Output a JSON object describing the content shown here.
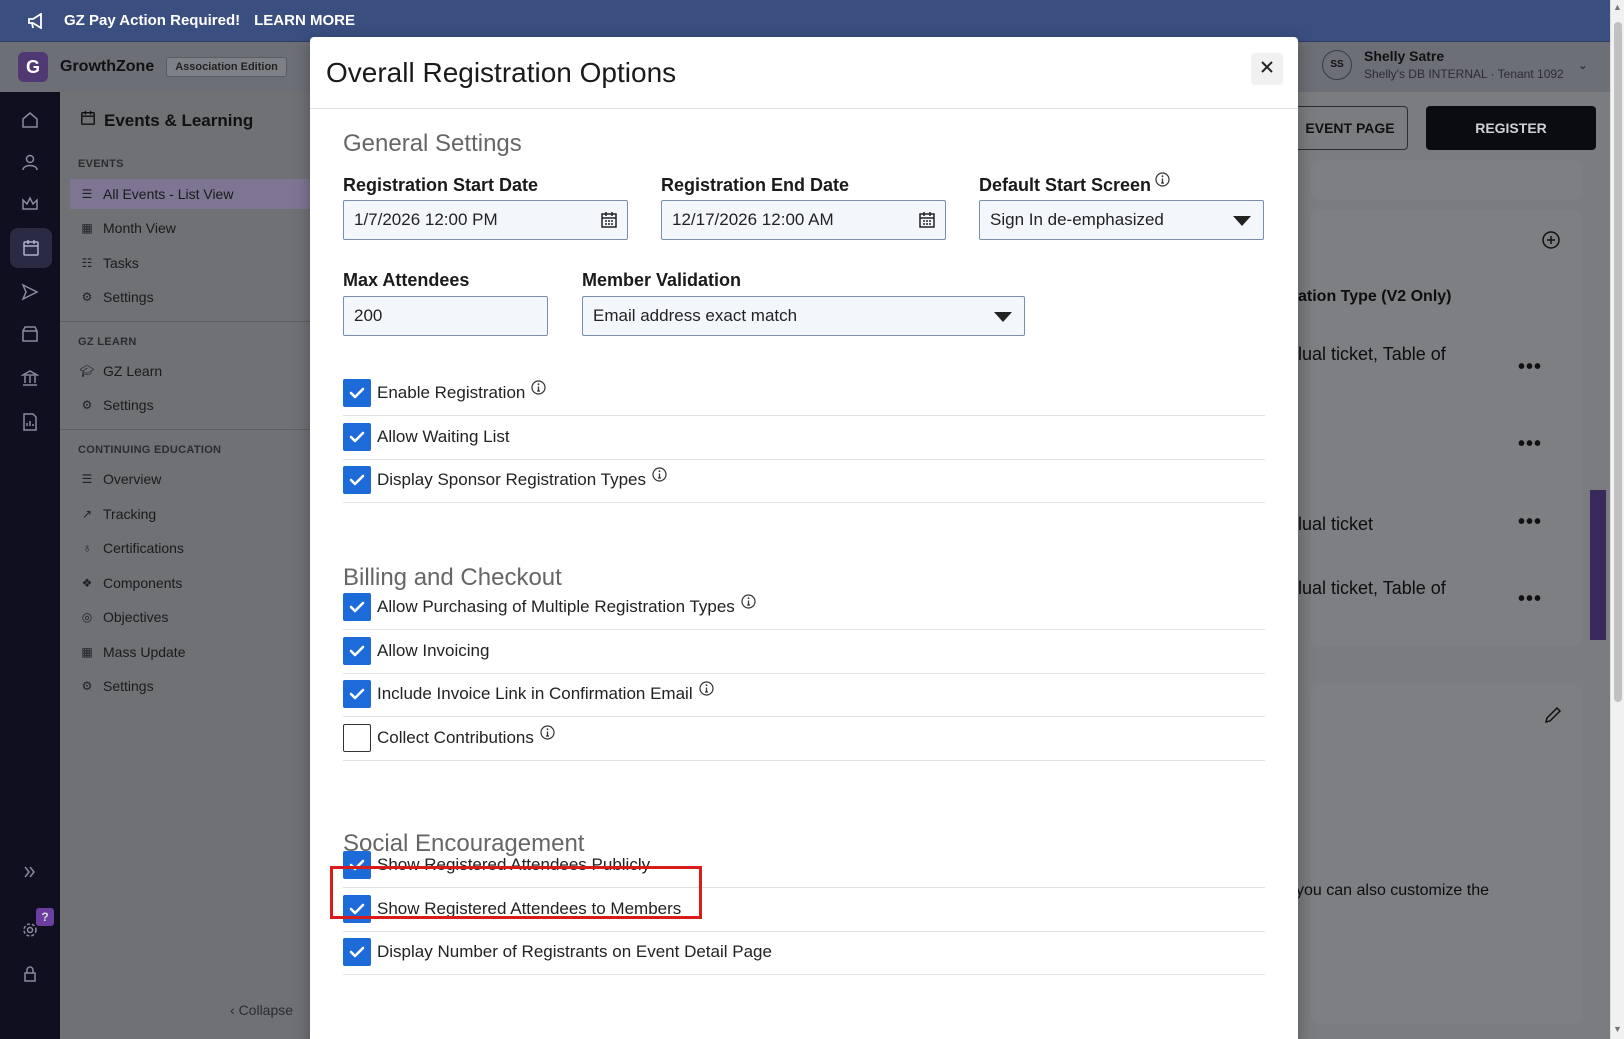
{
  "banner": {
    "text": "GZ Pay Action Required!",
    "link": "LEARN MORE"
  },
  "topbar": {
    "logo_letter": "G",
    "brand": "GrowthZone",
    "edition": "Association Edition",
    "user_initials": "SS",
    "user_name": "Shelly Satre",
    "user_sub": "Shelly's DB INTERNAL · Tenant 1092"
  },
  "sidenav": {
    "title": "Events & Learning",
    "sections": {
      "events": "EVENTS",
      "gz_learn": "GZ LEARN",
      "ce": "CONTINUING EDUCATION"
    },
    "events_items": [
      "All Events - List View",
      "Month View",
      "Tasks",
      "Settings"
    ],
    "learn_items": [
      "GZ Learn",
      "Settings"
    ],
    "ce_items": [
      "Overview",
      "Tracking",
      "Certifications",
      "Components",
      "Objectives",
      "Mass Update",
      "Settings"
    ],
    "collapse": "Collapse"
  },
  "content": {
    "event_page_btn": "EVENT PAGE",
    "register_btn": "REGISTER",
    "table_header": "ation Type (V2 Only)",
    "rows": [
      "lual ticket, Table of",
      "",
      "lual ticket",
      "lual ticket, Table of"
    ],
    "footer_text": "you can also customize the"
  },
  "modal": {
    "title": "Overall Registration Options",
    "general": {
      "heading": "General Settings",
      "reg_start_label": "Registration Start Date",
      "reg_start_value": "1/7/2026 12:00 PM",
      "reg_end_label": "Registration End Date",
      "reg_end_value": "12/17/2026 12:00 AM",
      "default_start_label": "Default Start Screen",
      "default_start_value": "Sign In de-emphasized",
      "max_att_label": "Max Attendees",
      "max_att_value": "200",
      "member_val_label": "Member Validation",
      "member_val_value": "Email address exact match"
    },
    "general_options": [
      {
        "label": "Enable Registration",
        "checked": true,
        "info": true
      },
      {
        "label": "Allow Waiting List",
        "checked": true,
        "info": false
      },
      {
        "label": "Display Sponsor Registration Types",
        "checked": true,
        "info": true
      }
    ],
    "billing": {
      "heading": "Billing and Checkout",
      "options": [
        {
          "label": "Allow Purchasing of Multiple Registration Types",
          "checked": true,
          "info": true
        },
        {
          "label": "Allow Invoicing",
          "checked": true,
          "info": false
        },
        {
          "label": "Include Invoice Link in Confirmation Email",
          "checked": true,
          "info": true
        },
        {
          "label": "Collect Contributions",
          "checked": false,
          "info": true
        }
      ]
    },
    "social": {
      "heading": "Social Encouragement",
      "options": [
        {
          "label": "Show Registered Attendees Publicly",
          "checked": true,
          "info": false
        },
        {
          "label": "Show Registered Attendees to Members",
          "checked": true,
          "info": false
        },
        {
          "label": "Display Number of Registrants on Event Detail Page",
          "checked": true,
          "info": false
        }
      ]
    }
  },
  "colors": {
    "checkbox": "#1c6bd9",
    "highlight": "#d81b1b",
    "banner": "#3a4e80"
  }
}
